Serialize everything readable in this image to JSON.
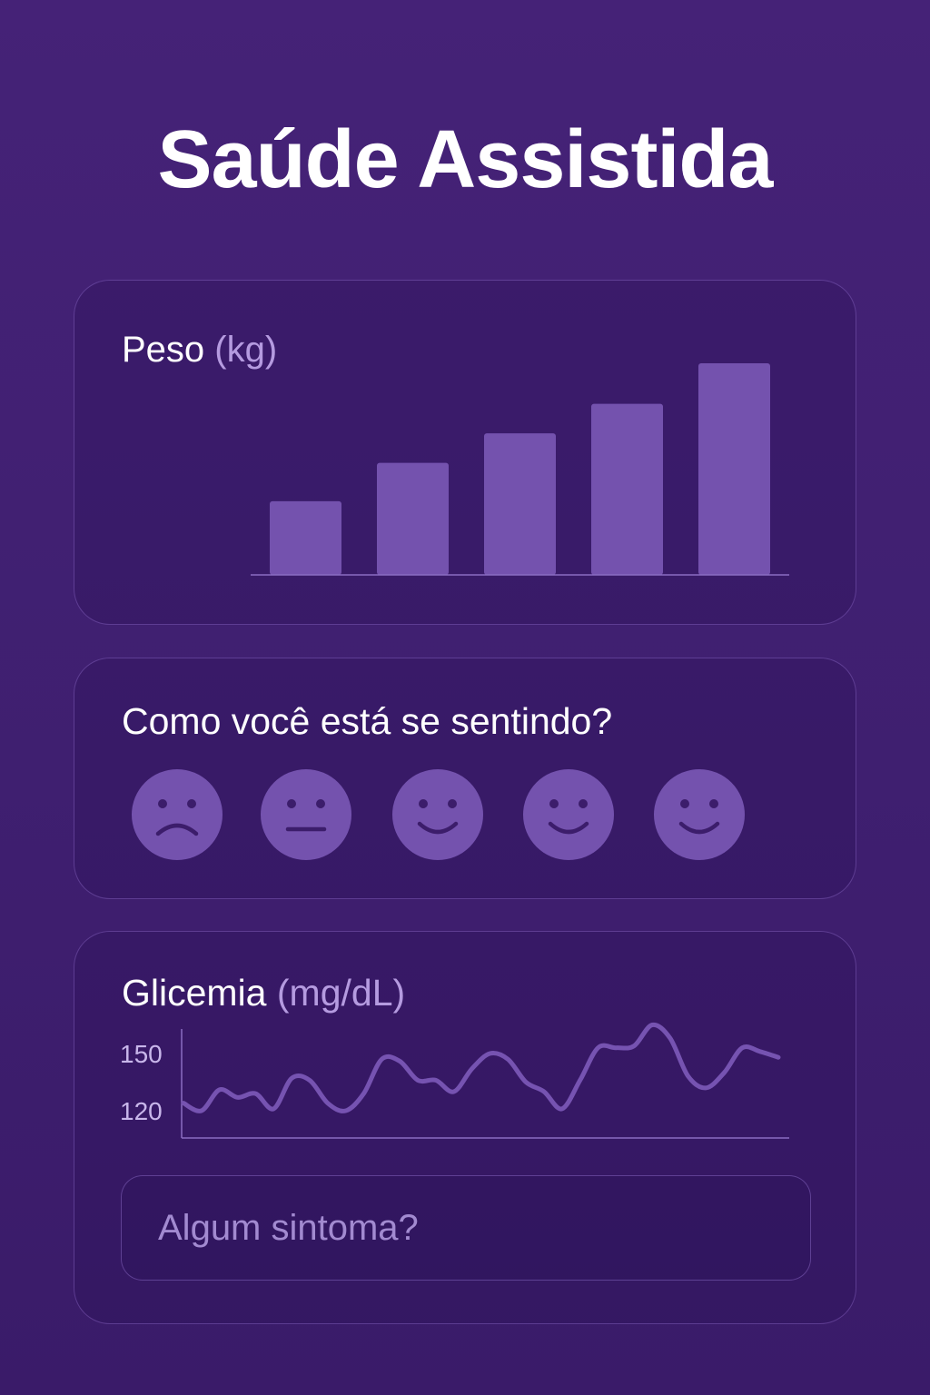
{
  "app": {
    "title": "Saúde Assistida"
  },
  "weight_card": {
    "title": "Peso",
    "unit": "(kg)"
  },
  "mood_card": {
    "question": "Como você está se sentindo?",
    "options": [
      {
        "icon": "sad-face-icon"
      },
      {
        "icon": "neutral-face-icon"
      },
      {
        "icon": "smiling-face-icon"
      },
      {
        "icon": "smiling-face-icon"
      },
      {
        "icon": "smiling-face-icon"
      }
    ]
  },
  "glucose_card": {
    "title": "Glicemia",
    "unit": "(mg/dL)"
  },
  "symptom_input": {
    "placeholder": "Algum sintoma?",
    "value": ""
  },
  "colors": {
    "background": "#442276",
    "accent": "#7452ae",
    "muted_text": "#b59be0"
  },
  "chart_data": [
    {
      "type": "bar",
      "title": "Peso (kg)",
      "values": [
        1.0,
        1.52,
        1.92,
        2.32,
        2.87
      ],
      "ylim": [
        0,
        2.87
      ],
      "grid": false,
      "legend": "none"
    },
    {
      "type": "line",
      "title": "Glicemia (mg/dL)",
      "yticks": [
        120,
        150
      ],
      "x": [
        0,
        1,
        2,
        3,
        4,
        5,
        6,
        7,
        8,
        9,
        10,
        11,
        12,
        13,
        14,
        15,
        16,
        17,
        18,
        19,
        20,
        21,
        22,
        23,
        24,
        25,
        26,
        27,
        28,
        29,
        30,
        31,
        32,
        33
      ],
      "y": [
        124,
        120,
        131,
        127,
        129,
        121,
        137,
        136,
        124,
        120,
        129,
        147,
        146,
        136,
        136,
        130,
        142,
        150,
        147,
        135,
        130,
        121,
        136,
        153,
        153,
        154,
        165,
        158,
        138,
        132,
        140,
        153,
        151,
        148
      ],
      "grid": false,
      "legend": "none"
    }
  ]
}
